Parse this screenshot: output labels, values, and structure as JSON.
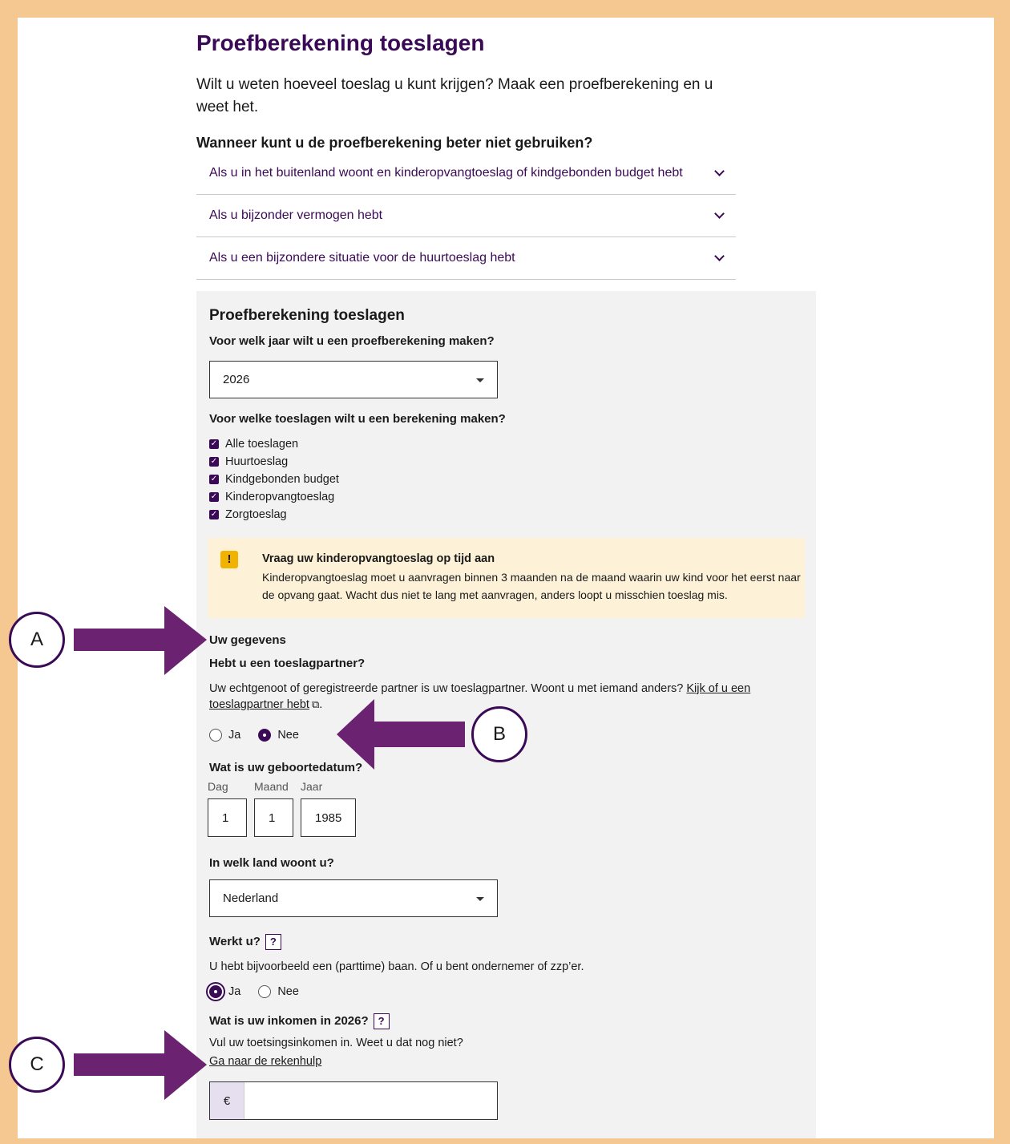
{
  "page": {
    "title": "Proefberekening toeslagen",
    "intro": "Wilt u weten hoeveel toeslag u kunt krijgen? Maak een proefberekening en u weet het.",
    "subheading": "Wanneer kunt u de proefberekening beter niet gebruiken?"
  },
  "accordion": [
    "Als u in het buitenland woont en kinderopvangtoeslag of kindgebonden budget hebt",
    "Als u bijzonder vermogen hebt",
    "Als u een bijzondere situatie voor de huurtoeslag hebt"
  ],
  "form": {
    "title": "Proefberekening toeslagen",
    "year_question": "Voor welk jaar wilt u een proefberekening maken?",
    "year_value": "2026",
    "benefits_question": "Voor welke toeslagen wilt u een berekening maken?",
    "benefits": [
      "Alle toeslagen",
      "Huurtoeslag",
      "Kindgebonden budget",
      "Kinderopvangtoeslag",
      "Zorgtoeslag"
    ],
    "alert_title": "Vraag uw kinderopvangtoeslag op tijd aan",
    "alert_body": "Kinderopvangtoeslag moet u aanvragen binnen 3 maanden na de maand waarin uw kind voor het eerst naar de opvang gaat. Wacht dus niet te lang met aanvragen, anders loopt u misschien toeslag mis.",
    "section_title": "Uw gegevens",
    "partner_question": "Hebt u een toeslagpartner?",
    "partner_text": "Uw echtgenoot of geregistreerde partner is uw toeslagpartner. Woont u met iemand anders?",
    "partner_link_1": "Kijk of u een",
    "partner_link_2": "toeslagpartner hebt",
    "period": ".",
    "yes": "Ja",
    "no": "Nee",
    "birth_question": "Wat is uw geboortedatum?",
    "day_label": "Dag",
    "month_label": "Maand",
    "year_label": "Jaar",
    "day": "1",
    "month": "1",
    "year": "1985",
    "country_question": "In welk land woont u?",
    "country_value": "Nederland",
    "work_question": "Werkt u?",
    "work_text": "U hebt bijvoorbeeld een (parttime) baan. Of u bent ondernemer of zzp’er.",
    "income_question": "Wat is uw inkomen in 2026?",
    "income_text": "Vul uw toetsingsinkomen in. Weet u dat nog niet?",
    "income_link": "Ga naar de rekenhulp",
    "currency": "€",
    "help": "?"
  },
  "markers": {
    "a": "A",
    "b": "B",
    "c": "C"
  },
  "colors": {
    "brand": "#3b0a57",
    "frame": "#f4c890",
    "panel": "#f2f2f2",
    "alert": "#fdf1d8"
  }
}
